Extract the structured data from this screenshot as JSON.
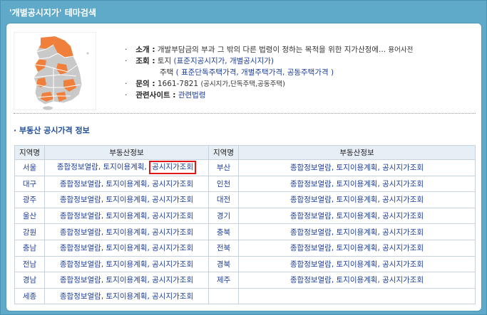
{
  "header": {
    "title": "'개별공시지가' 테마검색"
  },
  "intro": {
    "intro_label": "소개 :",
    "intro_text": "개발부담금의 부과 그 밖의 다른 법령이 정하는 목적을 위한 지가산정에...",
    "dictionary": "용어사전",
    "lookup_label": "조회 :",
    "lookup_land": "토지",
    "lookup_land_links": "(표준지공시지가, 개별공시지가)",
    "lookup_house": "주택",
    "lookup_house_links": "( 표준단독주택가격, 개별주택가격, 공동주택가격 )",
    "contact_label": "문의 :",
    "contact_text": "1661-7821",
    "contact_note": "(공시지가,단독주택,공동주택)",
    "related_label": "관련사이트 :",
    "related_link": "관련법령"
  },
  "section": {
    "title": "· 부동산 공시가격 정보"
  },
  "table": {
    "headers": [
      "지역명",
      "부동산정보",
      "지역명",
      "부동산정보"
    ],
    "link_text": "종합정보열람, 토지이용계획,",
    "highlight_link": "공시지가조회",
    "full_links": "종합정보열람, 토지이용계획, 공시지가조회",
    "rows": [
      {
        "left": "서울",
        "right": "부산"
      },
      {
        "left": "대구",
        "right": "인천"
      },
      {
        "left": "광주",
        "right": "대전"
      },
      {
        "left": "울산",
        "right": "경기"
      },
      {
        "left": "강원",
        "right": "충북"
      },
      {
        "left": "충남",
        "right": "전북"
      },
      {
        "left": "전남",
        "right": "경북"
      },
      {
        "left": "경남",
        "right": "제주"
      },
      {
        "left": "세종",
        "right": ""
      }
    ]
  },
  "colors": {
    "frame": "#5fa9c9",
    "link": "#1d3f9b",
    "highlight": "#e01818",
    "map_highlight": "#f07f3c",
    "map_base": "#c9c9c9"
  }
}
